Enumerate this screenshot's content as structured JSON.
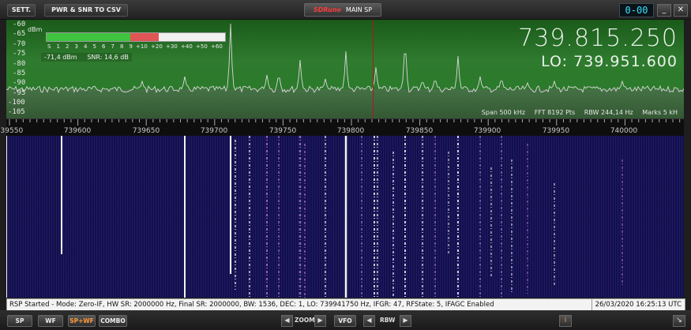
{
  "titlebar": {
    "settings_label": "SETT.",
    "csv_label": "PWR & SNR TO CSV",
    "brand": "SDRuno",
    "window_title": "MAIN SP",
    "clock": "0-00",
    "minimize": "_",
    "close": "✕"
  },
  "spectrum": {
    "y_unit": "dBm",
    "y_ticks": [
      "-60",
      "-65",
      "-70",
      "-75",
      "-80",
      "-85",
      "-90",
      "-95",
      "-100",
      "-105"
    ],
    "s_meter_scale": [
      "S",
      "1",
      "2",
      "3",
      "4",
      "5",
      "6",
      "7",
      "8",
      "9",
      "+10",
      "+20",
      "+30",
      "+40",
      "+50",
      "+60"
    ],
    "s_meter_green_fraction": 0.47,
    "s_meter_red_fraction": 0.16,
    "level": "-71,4 dBm",
    "snr": "SNR: 14,6 dB",
    "frequency": "739.815.250",
    "lo": "LO: 739.951.600",
    "span": "Span 500 kHz",
    "fft": "FFT 8192 Pts",
    "rbw": "RBW 244,14 Hz",
    "marks": "Marks 5 kH",
    "colors": {
      "trace": "#d8d8d8",
      "background": "#2e7a2e",
      "center_marker": "#b21818"
    }
  },
  "axis": {
    "labels": [
      "739550",
      "739600",
      "739650",
      "739700",
      "739750",
      "739800",
      "739850",
      "739900",
      "739950",
      "740000"
    ]
  },
  "waterfall": {
    "colors": {
      "background": "#11104a",
      "signal": "#ffffff",
      "weak": "#b07ad0"
    }
  },
  "status": {
    "message": "RSP Started - Mode: Zero-IF, HW SR: 2000000 Hz, Final SR: 2000000, BW: 1536, DEC: 1, LO: 739941750 Hz, IFGR: 47, RFState: 5, IFAGC Enabled",
    "datetime": "26/03/2020 16:25:13 UTC"
  },
  "bottombar": {
    "sp": "SP",
    "wf": "WF",
    "spwf": "SP+WF",
    "combo": "COMBO",
    "zoom": "ZOOM",
    "vfo": "VFO",
    "rbw": "RBW",
    "info": "i",
    "resize": "↘"
  }
}
